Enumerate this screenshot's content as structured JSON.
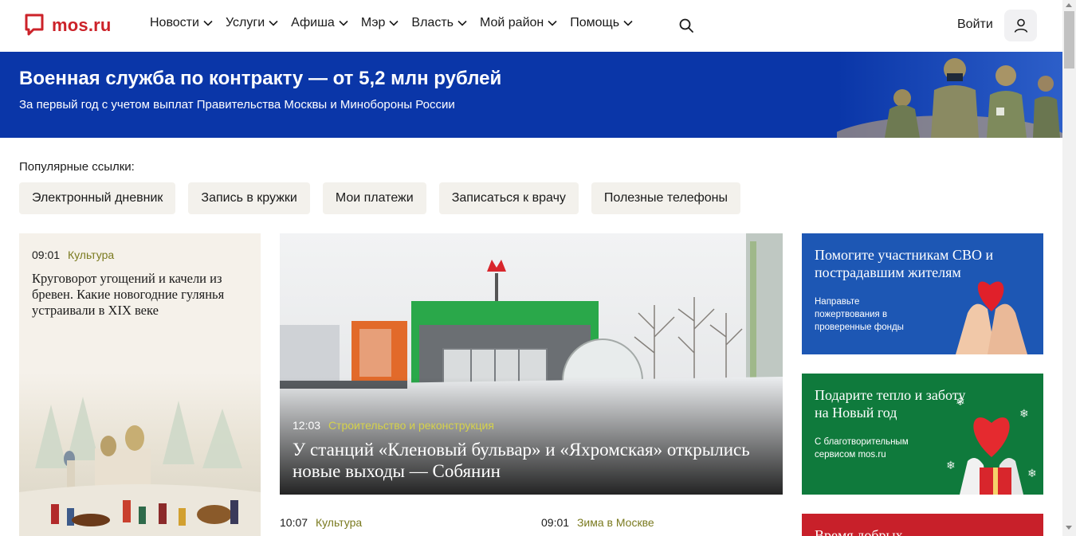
{
  "header": {
    "logo_text": "mos.ru",
    "nav": [
      "Новости",
      "Услуги",
      "Афиша",
      "Мэр",
      "Власть",
      "Мой район",
      "Помощь"
    ],
    "login": "Войти"
  },
  "banner": {
    "title": "Военная служба по контракту — от 5,2 млн рублей",
    "subtitle": "За первый год с учетом выплат Правительства Москвы и Минобороны России"
  },
  "popular": {
    "label": "Популярные ссылки:",
    "links": [
      "Электронный дневник",
      "Запись в кружки",
      "Мои платежи",
      "Записаться к врачу",
      "Полезные телефоны"
    ]
  },
  "left_card": {
    "time": "09:01",
    "category": "Культура",
    "title": "Круговорот угощений и качели из бревен. Какие новогодние гулянья устраивали в XIX веке"
  },
  "main_card": {
    "time": "12:03",
    "category": "Строительство и реконструкция",
    "title": "У станций «Кленовый бульвар» и «Яхромская» открылись новые выходы — Собянин"
  },
  "bottom": [
    {
      "time": "10:07",
      "category": "Культура"
    },
    {
      "time": "09:01",
      "category": "Зима в Москве"
    }
  ],
  "promos": [
    {
      "title": "Помогите участникам СВО и пострадавшим жителям",
      "subtitle": "Направьте пожертвования в проверенные фонды"
    },
    {
      "title": "Подарите тепло и заботу на Новый год",
      "subtitle": "С благотворительным сервисом mos.ru"
    },
    {
      "title": "Время добрых"
    }
  ],
  "colors": {
    "brand": "#cc2229",
    "banner": "#0a36a8",
    "category": "#7a7a1f"
  }
}
